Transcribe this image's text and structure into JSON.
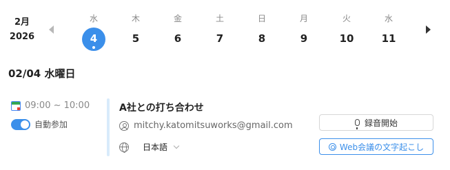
{
  "header": {
    "month": "2月",
    "year": "2026"
  },
  "days": [
    {
      "dow": "水",
      "num": "4",
      "selected": true
    },
    {
      "dow": "木",
      "num": "5"
    },
    {
      "dow": "金",
      "num": "6"
    },
    {
      "dow": "土",
      "num": "7"
    },
    {
      "dow": "日",
      "num": "8"
    },
    {
      "dow": "月",
      "num": "9"
    },
    {
      "dow": "火",
      "num": "10"
    },
    {
      "dow": "水",
      "num": "11"
    }
  ],
  "date_heading": "02/04 水曜日",
  "event": {
    "time": "09:00 ~ 10:00",
    "auto_join_label": "自動参加",
    "auto_join_enabled": true,
    "title": "A社との打ち合わせ",
    "email": "mitchy.katomitsuworks@gmail.com",
    "language": "日本語"
  },
  "buttons": {
    "record": "録音開始",
    "web_transcribe": "Web会議の文字起こし"
  },
  "icons": {
    "prev": "chevron-left-icon",
    "next": "chevron-right-icon",
    "calendar": "google-calendar-icon",
    "user": "user-icon",
    "globe": "globe-icon",
    "mic": "mic-icon",
    "web": "audio-wave-icon"
  },
  "colors": {
    "accent": "#3b8fea",
    "event_bar": "#d8ebfb"
  }
}
